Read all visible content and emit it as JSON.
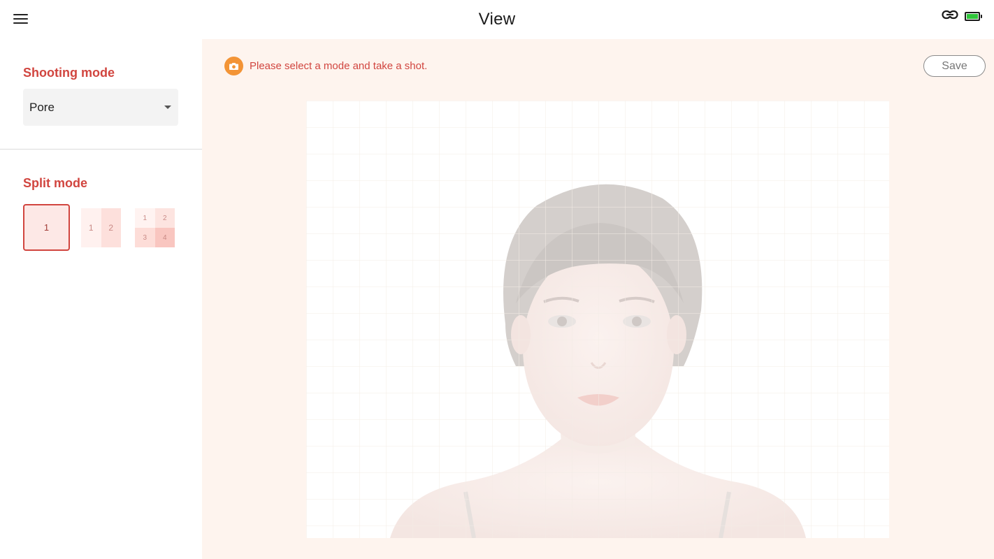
{
  "header": {
    "title": "View",
    "menu_icon": "hamburger-menu-icon",
    "link_icon": "link-icon",
    "battery_icon": "battery-icon",
    "battery_level": 1.0,
    "battery_color": "#2fc53a"
  },
  "sidebar": {
    "shooting_mode_label": "Shooting mode",
    "shooting_mode_value": "Pore",
    "split_mode_label": "Split mode",
    "split_options": [
      {
        "cells": [
          "1"
        ],
        "selected": true
      },
      {
        "cells": [
          "1",
          "2"
        ],
        "selected": false
      },
      {
        "cells": [
          "1",
          "2",
          "3",
          "4"
        ],
        "selected": false
      }
    ]
  },
  "main": {
    "notice_icon": "camera-icon",
    "notice_text": "Please select a mode and take a shot.",
    "save_label": "Save"
  },
  "colors": {
    "accent": "#d1453f",
    "notice_icon": "#f39436",
    "main_bg": "#fef4ee"
  }
}
